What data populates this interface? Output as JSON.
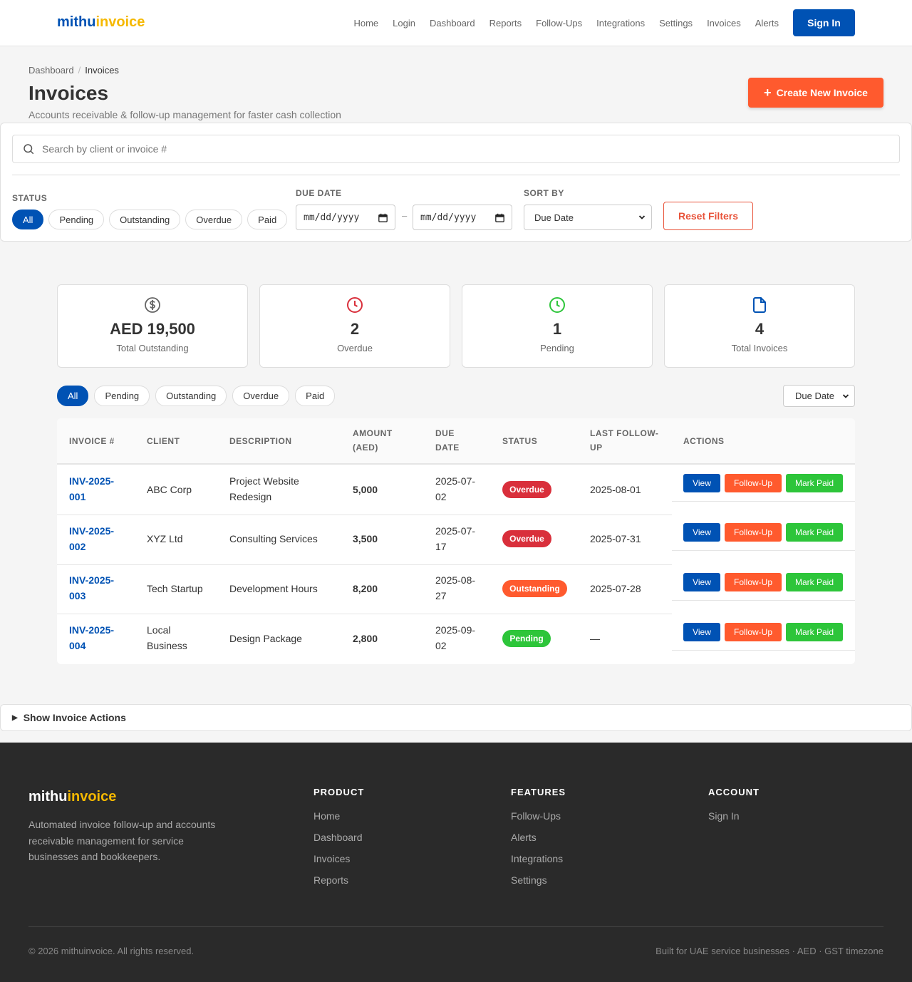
{
  "header": {
    "logo_a": "mithu",
    "logo_b": "invoice",
    "nav": [
      "Home",
      "Login",
      "Dashboard",
      "Reports",
      "Follow-Ups",
      "Integrations",
      "Settings",
      "Invoices",
      "Alerts"
    ],
    "signin_label": "Sign In"
  },
  "breadcrumb": {
    "parent": "Dashboard",
    "current": "Invoices"
  },
  "page": {
    "title": "Invoices",
    "subtitle": "Accounts receivable & follow-up management for faster cash collection",
    "create_label": "Create New Invoice"
  },
  "filters": {
    "search_placeholder": "Search by client or invoice #",
    "status_label": "STATUS",
    "status_options": [
      "All",
      "Pending",
      "Outstanding",
      "Overdue",
      "Paid"
    ],
    "status_selected": "All",
    "due_label": "DUE DATE",
    "date_from": "mm/dd/yyyy",
    "date_to": "mm/dd/yyyy",
    "date_sep": "–",
    "sort_label": "SORT BY",
    "sort_value": "Due Date",
    "reset_label": "Reset Filters"
  },
  "stats": [
    {
      "value": "AED 19,500",
      "label": "Total Outstanding",
      "icon": "dollar-circle-icon",
      "color": "#666666"
    },
    {
      "value": "2",
      "label": "Overdue",
      "icon": "clock-icon",
      "color": "#d92f3b"
    },
    {
      "value": "1",
      "label": "Pending",
      "icon": "clock-icon",
      "color": "#2dc53a"
    },
    {
      "value": "4",
      "label": "Total Invoices",
      "icon": "file-icon",
      "color": "#0052b4"
    }
  ],
  "table_filters": {
    "chips": [
      "All",
      "Pending",
      "Outstanding",
      "Overdue",
      "Paid"
    ],
    "sort_value": "Due Date"
  },
  "table": {
    "headers": {
      "invoice": "INVOICE #",
      "client": "CLIENT",
      "description": "DESCRIPTION",
      "amount": [
        "AMOUNT",
        "(AED)"
      ],
      "due": [
        "DUE",
        "DATE"
      ],
      "status": "STATUS",
      "followup": [
        "LAST FOLLOW-",
        "UP"
      ],
      "actions": "ACTIONS"
    },
    "rows": [
      {
        "invoice": [
          "INV-2025-",
          "001"
        ],
        "client": [
          "ABC Corp"
        ],
        "description": [
          "Project Website",
          "Redesign"
        ],
        "amount": "5,000",
        "due": [
          "2025-07-",
          "02"
        ],
        "status": "Overdue",
        "followup": "2025-08-01"
      },
      {
        "invoice": [
          "INV-2025-",
          "002"
        ],
        "client": [
          "XYZ Ltd"
        ],
        "description": [
          "Consulting Services"
        ],
        "amount": "3,500",
        "due": [
          "2025-07-",
          "17"
        ],
        "status": "Overdue",
        "followup": "2025-07-31"
      },
      {
        "invoice": [
          "INV-2025-",
          "003"
        ],
        "client": [
          "Tech Startup"
        ],
        "description": [
          "Development Hours"
        ],
        "amount": "8,200",
        "due": [
          "2025-08-",
          "27"
        ],
        "status": "Outstanding",
        "followup": "2025-07-28"
      },
      {
        "invoice": [
          "INV-2025-",
          "004"
        ],
        "client": [
          "Local",
          "Business"
        ],
        "description": [
          "Design Package"
        ],
        "amount": "2,800",
        "due": [
          "2025-09-",
          "02"
        ],
        "status": "Pending",
        "followup": "—"
      }
    ],
    "action_labels": {
      "view": "View",
      "followup": "Follow-Up",
      "paid": "Mark Paid"
    },
    "status_colors": {
      "Overdue": "#d92f3b",
      "Outstanding": "#ff5a2e",
      "Pending": "#2dc53a"
    }
  },
  "actions_bar": {
    "arrow": "▶",
    "label": "Show Invoice Actions"
  },
  "footer": {
    "logo_a": "mithu",
    "logo_b": "invoice",
    "description": "Automated invoice follow-up and accounts receivable management for service businesses and bookkeepers.",
    "columns": [
      {
        "title": "PRODUCT",
        "links": [
          "Home",
          "Dashboard",
          "Invoices",
          "Reports"
        ]
      },
      {
        "title": "FEATURES",
        "links": [
          "Follow-Ups",
          "Alerts",
          "Integrations",
          "Settings"
        ]
      },
      {
        "title": "ACCOUNT",
        "links": [
          "Sign In"
        ]
      }
    ],
    "copyright": "© 2026 mithuinvoice. All rights reserved.",
    "tagline": "Built for UAE service businesses · AED · GST timezone"
  }
}
